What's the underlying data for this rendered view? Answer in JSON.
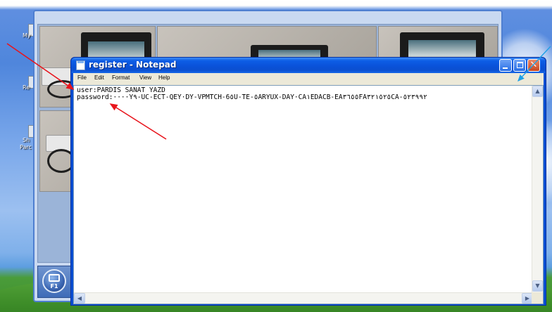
{
  "desktop": {
    "icon_labels": [
      "My",
      "Re",
      "Sh",
      "Parc"
    ]
  },
  "background_app": {
    "f1_label": "F1"
  },
  "notepad": {
    "title": "register - Notepad",
    "menu": [
      "File",
      "Edit",
      "Format",
      "View",
      "Help"
    ],
    "content_line1": "user:PARDIS SANAT YAZD",
    "content_line2": "password:····Y٩-UC-ECT-QEY·DY-VPMTCH-6٥U-TE-٥ARYUX-DAY·CA١EDACB-EA٣٦٥٥FA٣٢١٥٢٥CA-٥٢٣٩٩٢"
  },
  "colors": {
    "xp_title_blue": "#0a52d9",
    "arrow_red": "#e8141c",
    "arrow_blue": "#1ea0e6"
  }
}
